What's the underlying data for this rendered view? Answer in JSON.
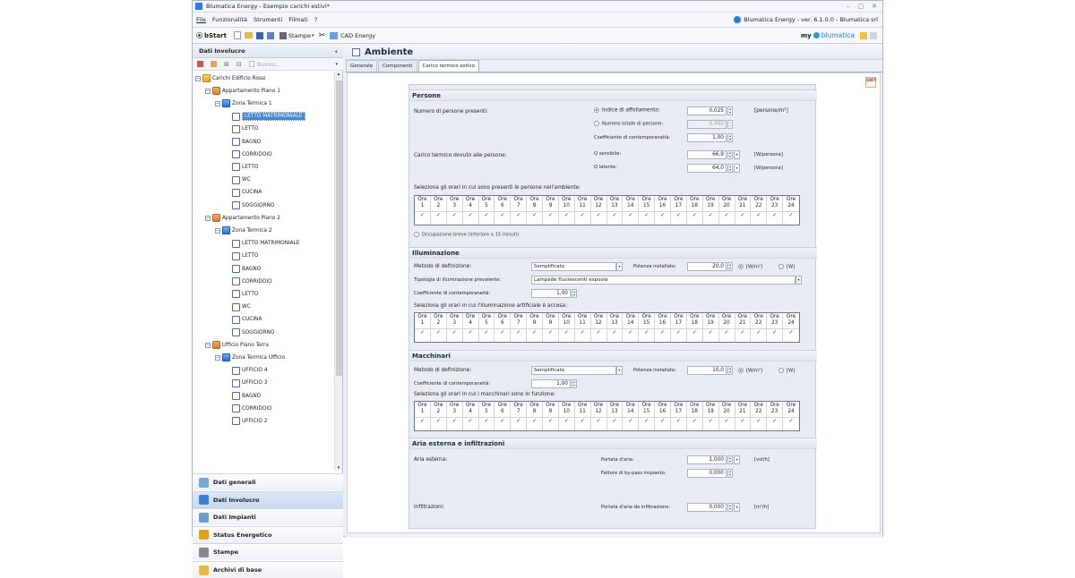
{
  "window": {
    "title": "Blumatica Energy - Esempio carichi estivi*",
    "controls": [
      "–",
      "▢",
      "✕"
    ]
  },
  "menu": {
    "items": [
      "File",
      "Funzionalità",
      "Strumenti",
      "Filmati",
      "?"
    ],
    "version": "Blumatica Energy - ver. 6.1.0.0 - Blumatica srl"
  },
  "toolbar": {
    "start": "bStart",
    "stampe": "Stampe",
    "cad": "CAD Energy",
    "brand_my": "my",
    "brand": "blumatica"
  },
  "left": {
    "header": "Dati Involucro",
    "collapse": "‹",
    "nuovo": "Nuovo...",
    "tree": [
      {
        "label": "Carichi Edificio Rossi",
        "level": 0,
        "icon": "folder",
        "exp": "−"
      },
      {
        "label": "Appartamento Piano 1",
        "level": 1,
        "icon": "home",
        "exp": "−"
      },
      {
        "label": "Zona Termica 1",
        "level": 2,
        "icon": "zone",
        "exp": "−"
      },
      {
        "label": "LETTO MATRIMONIALE",
        "level": 3,
        "icon": "room",
        "selected": true
      },
      {
        "label": "LETTO",
        "level": 3,
        "icon": "room"
      },
      {
        "label": "BAGNO",
        "level": 3,
        "icon": "room"
      },
      {
        "label": "CORRIDOIO",
        "level": 3,
        "icon": "room"
      },
      {
        "label": "LETTO",
        "level": 3,
        "icon": "room"
      },
      {
        "label": "WC",
        "level": 3,
        "icon": "room"
      },
      {
        "label": "CUCINA",
        "level": 3,
        "icon": "room"
      },
      {
        "label": "SOGGIORNO",
        "level": 3,
        "icon": "room"
      },
      {
        "label": "Appartamento Piano 2",
        "level": 1,
        "icon": "home",
        "exp": "−"
      },
      {
        "label": "Zona Termica 2",
        "level": 2,
        "icon": "zone",
        "exp": "−"
      },
      {
        "label": "LETTO MATRIMONIALE",
        "level": 3,
        "icon": "room"
      },
      {
        "label": "LETTO",
        "level": 3,
        "icon": "room"
      },
      {
        "label": "BAGNO",
        "level": 3,
        "icon": "room"
      },
      {
        "label": "CORRIDOIO",
        "level": 3,
        "icon": "room"
      },
      {
        "label": "LETTO",
        "level": 3,
        "icon": "room"
      },
      {
        "label": "WC",
        "level": 3,
        "icon": "room"
      },
      {
        "label": "CUCINA",
        "level": 3,
        "icon": "room"
      },
      {
        "label": "SOGGIORNO",
        "level": 3,
        "icon": "room"
      },
      {
        "label": "Ufficio Piano Terra",
        "level": 1,
        "icon": "home",
        "exp": "−"
      },
      {
        "label": "Zona Termica Ufficio",
        "level": 2,
        "icon": "zone",
        "exp": "−"
      },
      {
        "label": "UFFICIO 4",
        "level": 3,
        "icon": "room"
      },
      {
        "label": "UFFICIO 3",
        "level": 3,
        "icon": "room"
      },
      {
        "label": "BAGNO",
        "level": 3,
        "icon": "room"
      },
      {
        "label": "CORRIDOIO",
        "level": 3,
        "icon": "room"
      },
      {
        "label": "UFFICIO 2",
        "level": 3,
        "icon": "room"
      }
    ],
    "nav": [
      {
        "label": "Dati generali",
        "color": "#7aa6d6"
      },
      {
        "label": "Dati Involucro",
        "color": "#3f7fd0",
        "active": true
      },
      {
        "label": "Dati Impianti",
        "color": "#6c9bd1"
      },
      {
        "label": "Status Energetico",
        "color": "#e0a020"
      },
      {
        "label": "Stampe",
        "color": "#8a8a8a"
      },
      {
        "label": "Archivi di base",
        "color": "#e5b84a"
      }
    ]
  },
  "main": {
    "title": "Ambiente",
    "tabs": [
      "Generale",
      "Componenti",
      "Carico termico estivo"
    ],
    "active_tab": 2,
    "corner_icon": "SWIT",
    "hours_header": "Ore",
    "persone": {
      "title": "Persone",
      "num_label": "Numero di persone presenti:",
      "opt1": "Indice di affollamento:",
      "opt1_val": "0,025",
      "opt1_unit": "[persone/m²]",
      "opt2": "Numero totale di persone:",
      "opt2_val": "0,493",
      "coeff_label": "Coefficiente di contemporaneità:",
      "coeff_val": "1,00",
      "carico_label": "Carico termico dovuto alle persone:",
      "qs_label": "Q sensibile:",
      "qs_val": "66,9",
      "qs_unit": "[W/persona]",
      "ql_label": "Q latente:",
      "ql_val": "64,0",
      "ql_unit": "[W/persona]",
      "hours_label": "Seleziona gli orari in cui sono presenti le persone nell'ambiente:",
      "breve": "Occupazione breve (inferiore a 15 minuti)"
    },
    "illum": {
      "title": "Illuminazione",
      "metodo_label": "Metodo di definizione:",
      "metodo_val": "Semplificato",
      "pot_label": "Potenza installata:",
      "pot_val": "20,0",
      "unit1": "[W/m²]",
      "unit2": "[W]",
      "tip_label": "Tipologia di illuminazione prevalente:",
      "tip_val": "Lampade fluorescenti esposte",
      "coeff_label": "Coefficiente di contemporaneità:",
      "coeff_val": "1,00",
      "hours_label": "Seleziona gli orari in cui l'illuminazione artificiale è accesa:"
    },
    "macch": {
      "title": "Macchinari",
      "metodo_label": "Metodo di definizione:",
      "metodo_val": "Semplificato",
      "pot_label": "Potenza installata:",
      "pot_val": "10,0",
      "unit1": "[W/m²]",
      "unit2": "[W]",
      "coeff_label": "Coefficiente di contemporaneità:",
      "coeff_val": "1,00",
      "hours_label": "Seleziona gli orari in cui i macchinari sono in funzione:"
    },
    "aria": {
      "title": "Aria esterna e infiltrazioni",
      "ext_label": "Aria esterna:",
      "portata_label": "Portata d'aria:",
      "portata_val": "1,000",
      "portata_unit": "[vol/h]",
      "bypass_label": "Fattore di by-pass impianto:",
      "bypass_val": "0,000",
      "inf_label": "Infiltrazioni:",
      "inf_portata_label": "Portata d'aria da infiltrazione:",
      "inf_val": "0,000",
      "inf_unit": "[m³/h]"
    }
  }
}
